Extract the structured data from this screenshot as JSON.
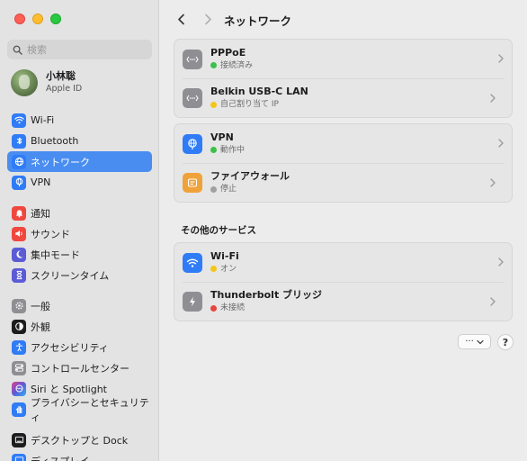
{
  "sidebar": {
    "search_placeholder": "検索",
    "account": {
      "name": "小林聡",
      "subtitle": "Apple ID"
    },
    "items": [
      {
        "label": "Wi-Fi",
        "icon": "wifi-icon",
        "color": "#2f7cf6"
      },
      {
        "label": "Bluetooth",
        "icon": "bluetooth-icon",
        "color": "#2f7cf6"
      },
      {
        "label": "ネットワーク",
        "icon": "globe-icon",
        "color": "#2f7cf6",
        "selected": true
      },
      {
        "label": "VPN",
        "icon": "vpn-globe-icon",
        "color": "#2f7cf6"
      },
      {
        "label": "通知",
        "icon": "bell-icon",
        "color": "#f0473f"
      },
      {
        "label": "サウンド",
        "icon": "speaker-icon",
        "color": "#f0473f"
      },
      {
        "label": "集中モード",
        "icon": "moon-icon",
        "color": "#5b5bd6"
      },
      {
        "label": "スクリーンタイム",
        "icon": "hourglass-icon",
        "color": "#5b5bd6"
      },
      {
        "label": "一般",
        "icon": "gear-icon",
        "color": "#8e8e93"
      },
      {
        "label": "外観",
        "icon": "appearance-icon",
        "color": "#1d1d1f"
      },
      {
        "label": "アクセシビリティ",
        "icon": "accessibility-icon",
        "color": "#2f7cf6"
      },
      {
        "label": "コントロールセンター",
        "icon": "switches-icon",
        "color": "#8e8e93"
      },
      {
        "label": "Siri と Spotlight",
        "icon": "siri-icon",
        "color": "#9b4fd6"
      },
      {
        "label": "プライバシーとセキュリティ",
        "icon": "hand-icon",
        "color": "#2f7cf6"
      },
      {
        "label": "デスクトップと Dock",
        "icon": "dock-icon",
        "color": "#1d1d1f"
      },
      {
        "label": "ディスプレイ",
        "icon": "display-icon",
        "color": "#2f7cf6"
      }
    ]
  },
  "header": {
    "title": "ネットワーク"
  },
  "groups": [
    {
      "rows": [
        {
          "title": "PPPoE",
          "status": "接続済み",
          "status_color": "#3bc04a",
          "icon": "network-dots-icon",
          "icon_bg": "#8e8e93"
        },
        {
          "title": "Belkin USB-C LAN",
          "status": "自己割り当て IP",
          "status_color": "#f5c518",
          "icon": "ethernet-icon",
          "icon_bg": "#8e8e93"
        }
      ]
    },
    {
      "rows": [
        {
          "title": "VPN",
          "status": "動作中",
          "status_color": "#3bc04a",
          "icon": "vpn-icon",
          "icon_bg": "#2f7cf6"
        },
        {
          "title": "ファイアウォール",
          "status": "停止",
          "status_color": "#a0a0a0",
          "icon": "firewall-icon",
          "icon_bg": "#f0a23a"
        }
      ]
    }
  ],
  "other_services": {
    "title": "その他のサービス",
    "rows": [
      {
        "title": "Wi-Fi",
        "status": "オン",
        "status_color": "#f5c518",
        "icon": "wifi-icon",
        "icon_bg": "#2f7cf6"
      },
      {
        "title": "Thunderbolt ブリッジ",
        "status": "未接続",
        "status_color": "#e8453c",
        "icon": "thunderbolt-icon",
        "icon_bg": "#8e8e93"
      }
    ]
  },
  "footer": {
    "more_label": "···",
    "help_label": "?"
  }
}
